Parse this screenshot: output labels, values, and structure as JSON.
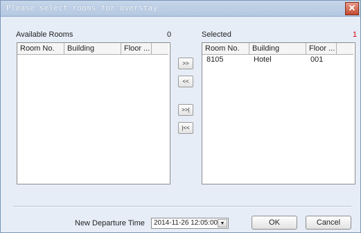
{
  "window": {
    "title": "Please select rooms for overstay"
  },
  "icons": {
    "close": "close-x-icon",
    "dropdown": "chevron-down-icon"
  },
  "available": {
    "label": "Available Rooms",
    "count": "0",
    "columns": [
      "Room No.",
      "Building",
      "Floor ..."
    ],
    "rows": []
  },
  "selected": {
    "label": "Selected",
    "count": "1",
    "columns": [
      "Room No.",
      "Building",
      "Floor ..."
    ],
    "rows": [
      [
        "8105",
        "Hotel",
        "001"
      ]
    ]
  },
  "transfer": {
    "add": ">>",
    "remove": "<<",
    "add_all": ">>|",
    "remove_all": "|<<"
  },
  "departure": {
    "label": "New Departure Time",
    "value": "2014-11-26 12:05:00"
  },
  "buttons": {
    "ok": "OK",
    "cancel": "Cancel"
  },
  "colors": {
    "count_selected": "#dd0000",
    "title_bar": "#b4c8e1"
  }
}
